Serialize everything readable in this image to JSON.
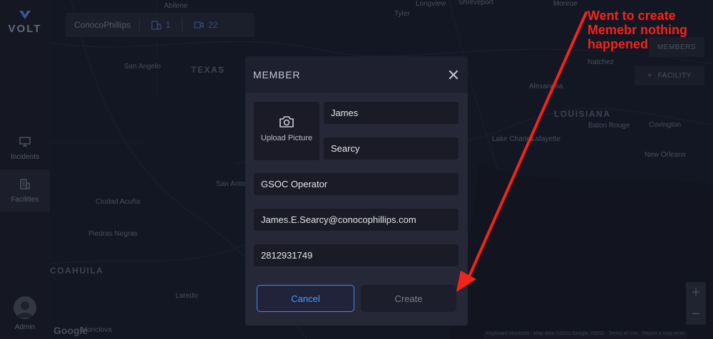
{
  "app": {
    "logo_text": "VOLT"
  },
  "sidebar": {
    "items": [
      {
        "label": "Incidents",
        "icon": "monitor-icon"
      },
      {
        "label": "Facilities",
        "icon": "building-icon"
      }
    ],
    "admin_label": "Admin"
  },
  "header": {
    "company": "ConocoPhillips",
    "facilities_count": "1",
    "cameras_count": "22"
  },
  "map_controls": {
    "members_label": "MEMBERS",
    "facility_label": "FACILITY",
    "facility_plus": "+",
    "zoom_in": "+",
    "zoom_out": "−",
    "google": "Google",
    "attribution": [
      "Keyboard shortcuts",
      "Map data ©2021 Google, INEGI",
      "Terms of Use",
      "Report a map error"
    ]
  },
  "map_labels": {
    "states": [
      "TEXAS",
      "LOUISIANA",
      "COAHUILA"
    ],
    "cities": [
      "Abilene",
      "Longview",
      "Shreveport",
      "Monroe",
      "Tyler",
      "San Angelo",
      "Natchez",
      "Alexandria",
      "Baton Rouge",
      "Lafayette",
      "Lake Charles",
      "New Orleans",
      "San Antonio",
      "Ciudad Acuña",
      "Piedras Negras",
      "Laredo",
      "Monclova",
      "Covington"
    ]
  },
  "modal": {
    "title": "MEMBER",
    "upload_label": "Upload Picture",
    "first_name": "James",
    "last_name": "Searcy",
    "role": "GSOC Operator",
    "email": "James.E.Searcy@conocophillips.com",
    "phone": "2812931749",
    "cancel_label": "Cancel",
    "create_label": "Create"
  },
  "annotation": {
    "text": "Went to create Memebr nothing happened",
    "color": "#f3241b"
  },
  "colors": {
    "accent": "#3d8bff",
    "panel": "#262837",
    "field": "#1a1b26"
  }
}
